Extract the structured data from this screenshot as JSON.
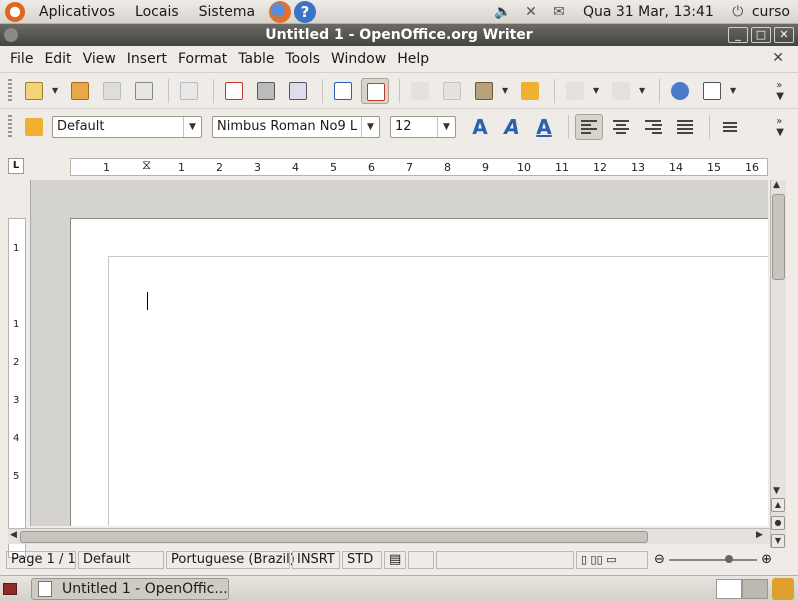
{
  "panel": {
    "menus": [
      "Aplicativos",
      "Locais",
      "Sistema"
    ],
    "clock": "Qua 31 Mar, 13:41",
    "user": "curso"
  },
  "window": {
    "title": "Untitled 1 - OpenOffice.org Writer"
  },
  "menubar": {
    "items": [
      "File",
      "Edit",
      "View",
      "Insert",
      "Format",
      "Table",
      "Tools",
      "Window",
      "Help"
    ]
  },
  "formatting": {
    "paragraph_style": "Default",
    "font_name": "Nimbus Roman No9 L",
    "font_size": "12"
  },
  "ruler": {
    "h_ticks": [
      "1",
      "1",
      "2",
      "3",
      "4",
      "5",
      "6",
      "7",
      "8",
      "9",
      "10",
      "11",
      "12",
      "13",
      "14",
      "15",
      "16"
    ],
    "v_ticks": [
      "1",
      "1",
      "2",
      "3",
      "4",
      "5"
    ]
  },
  "statusbar": {
    "page": "Page 1 / 1",
    "page_style": "Default",
    "language": "Portuguese (Brazil)",
    "insert_mode": "INSRT",
    "selection_mode": "STD"
  },
  "taskbar": {
    "task_label": "Untitled 1 - OpenOffic..."
  }
}
